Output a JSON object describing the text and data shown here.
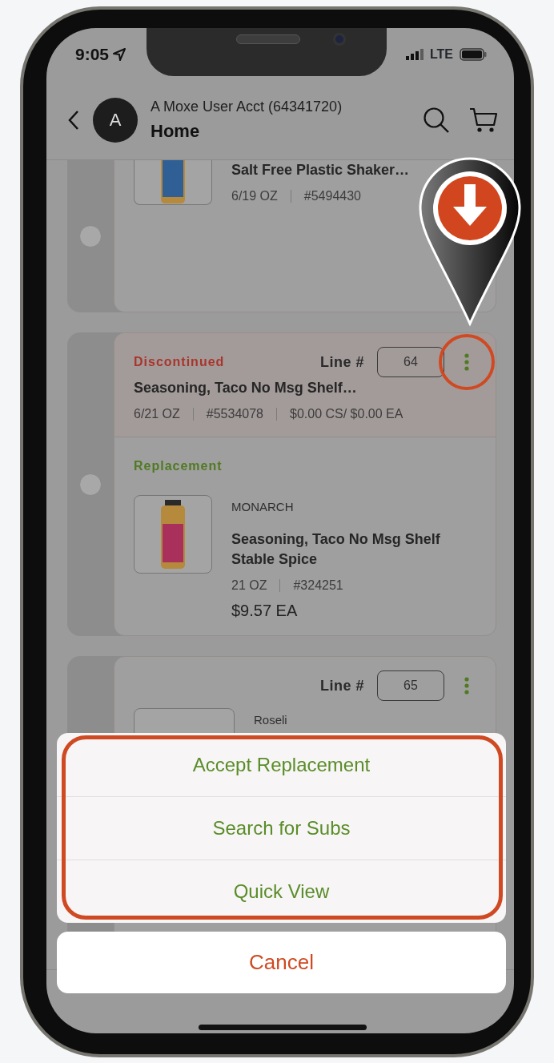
{
  "status_bar": {
    "time": "9:05",
    "network": "LTE"
  },
  "header": {
    "avatar_initial": "A",
    "account": "A Moxe User Acct (64341720)",
    "title": "Home"
  },
  "items": [
    {
      "kind": "partial",
      "selected": false,
      "name": "Salt Free Plastic Shaker…",
      "meta": [
        "6/19 OZ",
        "#5494430"
      ]
    },
    {
      "kind": "replacement",
      "selected": false,
      "status": "Discontinued",
      "line_label": "Line #",
      "line": "64",
      "name": "Seasoning, Taco No Msg Shelf…",
      "meta": [
        "6/21 OZ",
        "#5534078",
        "$0.00 CS/ $0.00 EA"
      ],
      "replacement": {
        "label": "Replacement",
        "brand": "MONARCH",
        "name": "Seasoning, Taco No Msg Shelf Stable Spice",
        "meta": [
          "21 OZ",
          "#324251"
        ],
        "price": "$9.57 EA"
      }
    },
    {
      "kind": "covered",
      "line_label": "Line #",
      "line": "65",
      "brand": "Roseli"
    }
  ],
  "action_sheet": {
    "actions": [
      "Accept Replacement",
      "Search for Subs",
      "Quick View"
    ],
    "cancel": "Cancel"
  }
}
